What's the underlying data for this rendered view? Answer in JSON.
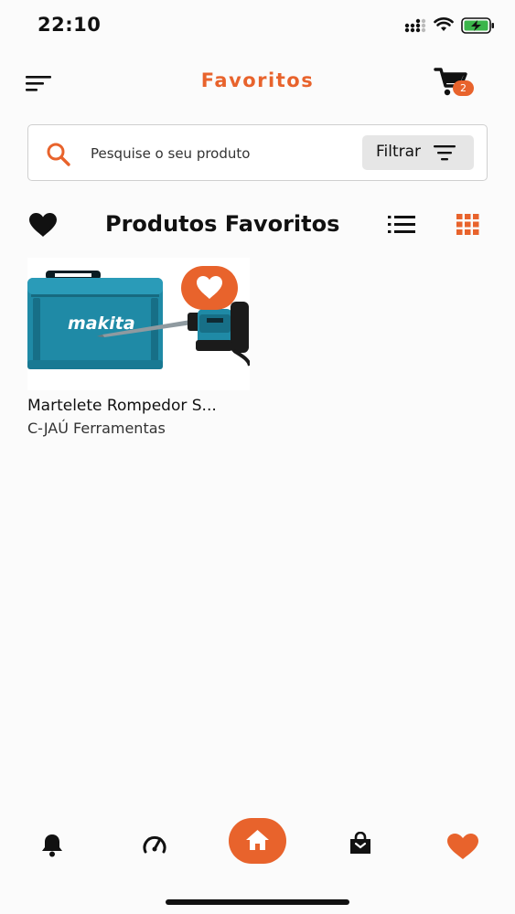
{
  "status_bar": {
    "time": "22:10"
  },
  "header": {
    "title": "Favoritos",
    "cart_count": "2"
  },
  "search": {
    "placeholder": "Pesquise o seu produto",
    "filter_label": "Filtrar"
  },
  "section": {
    "title": "Produtos Favoritos"
  },
  "products": [
    {
      "name": "Martelete Rompedor S...",
      "seller": "C-JAÚ Ferramentas",
      "image_text": "makita",
      "favorited": true
    }
  ],
  "bottom_nav": {
    "items": [
      "bell-icon",
      "speedometer-icon",
      "home-icon",
      "shopping-bag-icon",
      "heart-icon"
    ],
    "active": "heart-icon"
  },
  "colors": {
    "accent": "#e8632c",
    "text": "#111111",
    "background": "#fbfbfb",
    "case": "#1f8aa6"
  }
}
